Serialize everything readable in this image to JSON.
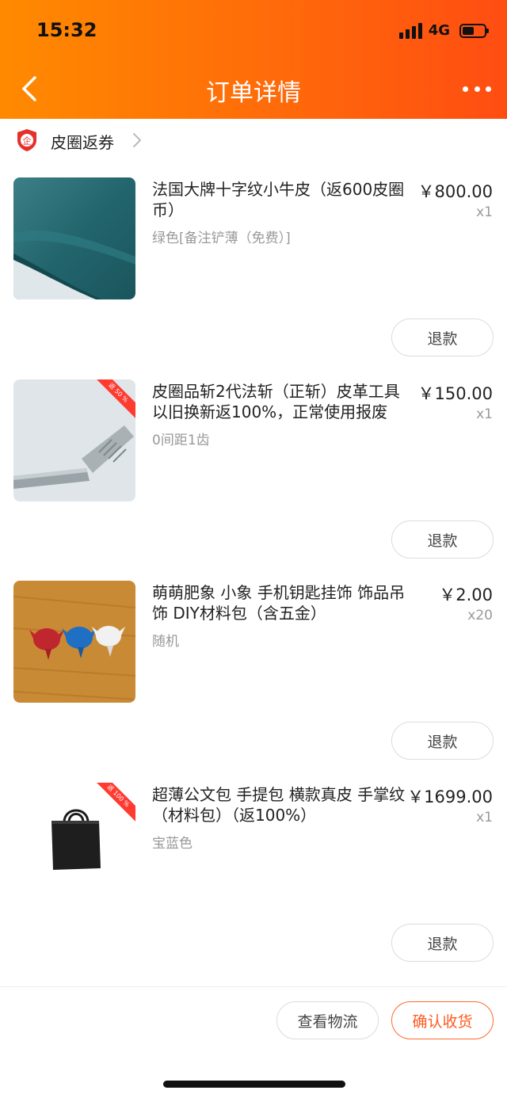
{
  "status_bar": {
    "time": "15:32",
    "network": "4G"
  },
  "header": {
    "title": "订单详情",
    "back_icon": "chevron-left-icon",
    "more_icon": "more-dots-icon"
  },
  "shop": {
    "name": "皮圈返券",
    "badge_char": "企"
  },
  "items": [
    {
      "name": "法国大牌十字纹小牛皮（返600皮圈币）",
      "spec": "绿色[备注铲薄（免费）]",
      "price": "￥800.00",
      "qty": "x1",
      "refund_label": "退款",
      "ribbon": ""
    },
    {
      "name": "皮圈品斩2代法斩（正斩）皮革工具 以旧换新返100%，正常使用报废",
      "spec": "0间距1齿",
      "price": "￥150.00",
      "qty": "x1",
      "refund_label": "退款",
      "ribbon": "返 50 %"
    },
    {
      "name": "萌萌肥象 小象 手机钥匙挂饰 饰品吊饰 DIY材料包（含五金）",
      "spec": "随机",
      "price": "￥2.00",
      "qty": "x20",
      "refund_label": "退款",
      "ribbon": ""
    },
    {
      "name": "超薄公文包 手提包 横款真皮 手掌纹（材料包）（返100%）",
      "spec": "宝蓝色",
      "price": "￥1699.00",
      "qty": "x1",
      "refund_label": "退款",
      "ribbon": "返 100 %"
    }
  ],
  "footer": {
    "logistics_label": "查看物流",
    "confirm_label": "确认收货"
  },
  "colors": {
    "header_start": "#ff8a00",
    "header_end": "#ff4d12",
    "accent": "#ff5a1f",
    "ribbon": "#ff3b30"
  }
}
